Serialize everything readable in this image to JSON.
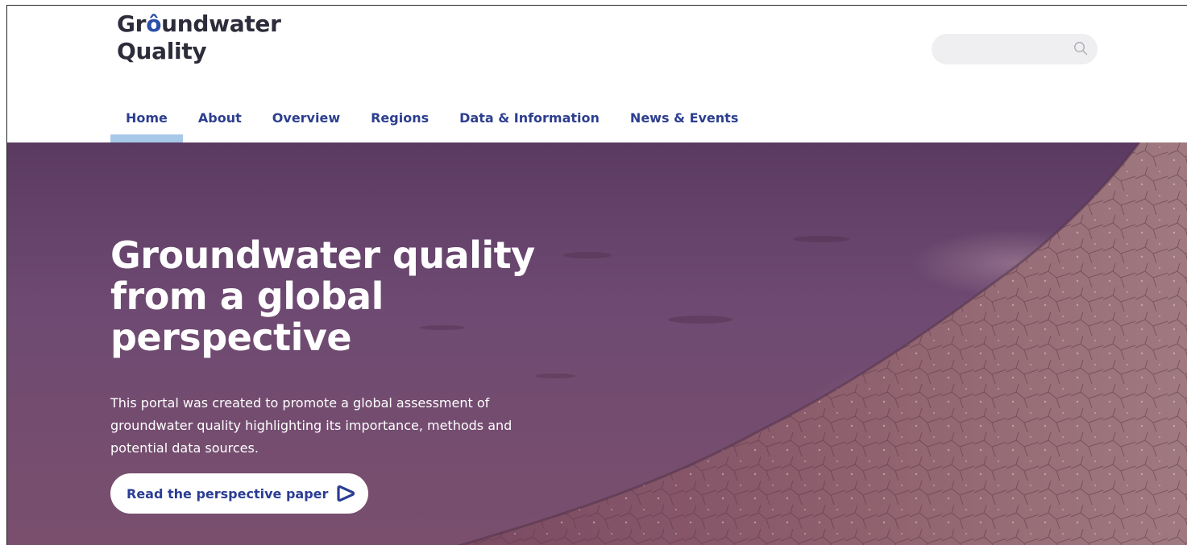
{
  "brand": {
    "line1_pre": "Gr",
    "line1_drop": "ô",
    "line1_post": "undwater",
    "line2": "Quality",
    "accent_color": "#2b4fa8"
  },
  "search": {
    "placeholder": "",
    "icon": "search-icon"
  },
  "nav": {
    "items": [
      {
        "label": "Home",
        "active": true
      },
      {
        "label": "About",
        "active": false
      },
      {
        "label": "Overview",
        "active": false
      },
      {
        "label": "Regions",
        "active": false
      },
      {
        "label": "Data & Information",
        "active": false
      },
      {
        "label": "News & Events",
        "active": false
      }
    ],
    "active_indicator_color": "#a8c8e8",
    "text_color": "#2d3f8f"
  },
  "hero": {
    "title": "Groundwater quality from a global perspective",
    "description": "This portal was created to promote a global assessment of groundwater quality highlighting its importance, methods and potential data sources.",
    "cta_label": "Read the perspective paper",
    "cta_icon": "arrow-circle-right-icon",
    "cta_text_color": "#2b3d93"
  }
}
